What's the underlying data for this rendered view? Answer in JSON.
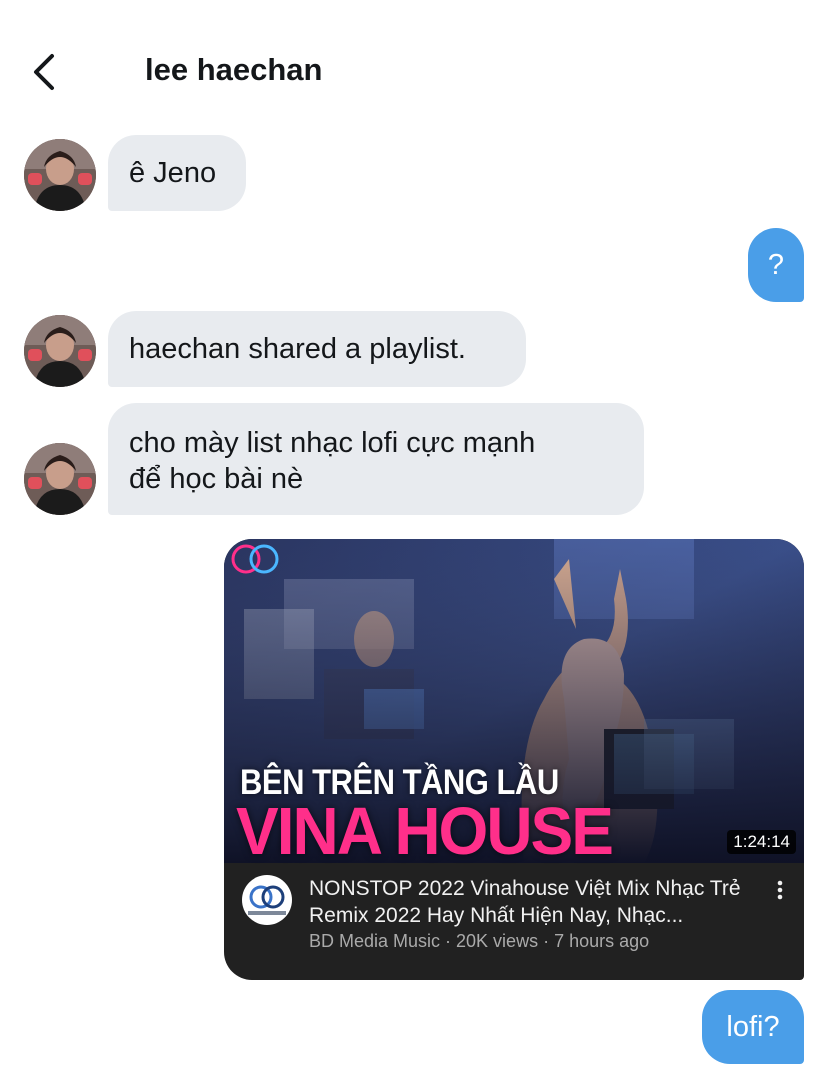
{
  "header": {
    "title": "lee haechan",
    "back_icon": "chevron-left-icon"
  },
  "messages": [
    {
      "side": "in",
      "text": "ê Jeno"
    },
    {
      "side": "out",
      "text": "?"
    },
    {
      "side": "in",
      "text": "haechan shared a playlist."
    },
    {
      "side": "in",
      "text": "cho mày list nhạc lofi cực mạnh\nđể học bài nè"
    },
    {
      "side": "out",
      "text": "lofi?"
    }
  ],
  "video": {
    "thumbnail_text_1": "BÊN TRÊN TẦNG LẦU",
    "thumbnail_text_2": "VINA HOUSE",
    "duration": "1:24:14",
    "title": "NONSTOP 2022 Vinahouse Việt Mix Nhạc Trẻ Remix 2022 Hay Nhất Hiện Nay, Nhạc...",
    "meta": "BD Media Music · 20K views · 7 hours ago",
    "channel_logo_text": "BD MEDIA",
    "more_icon": "more-vertical-icon"
  },
  "colors": {
    "outgoing_bubble": "#4a9ee8",
    "incoming_bubble": "#e8ebef",
    "card_background": "#212121",
    "thumbnail_accent": "#ff2f8a"
  }
}
